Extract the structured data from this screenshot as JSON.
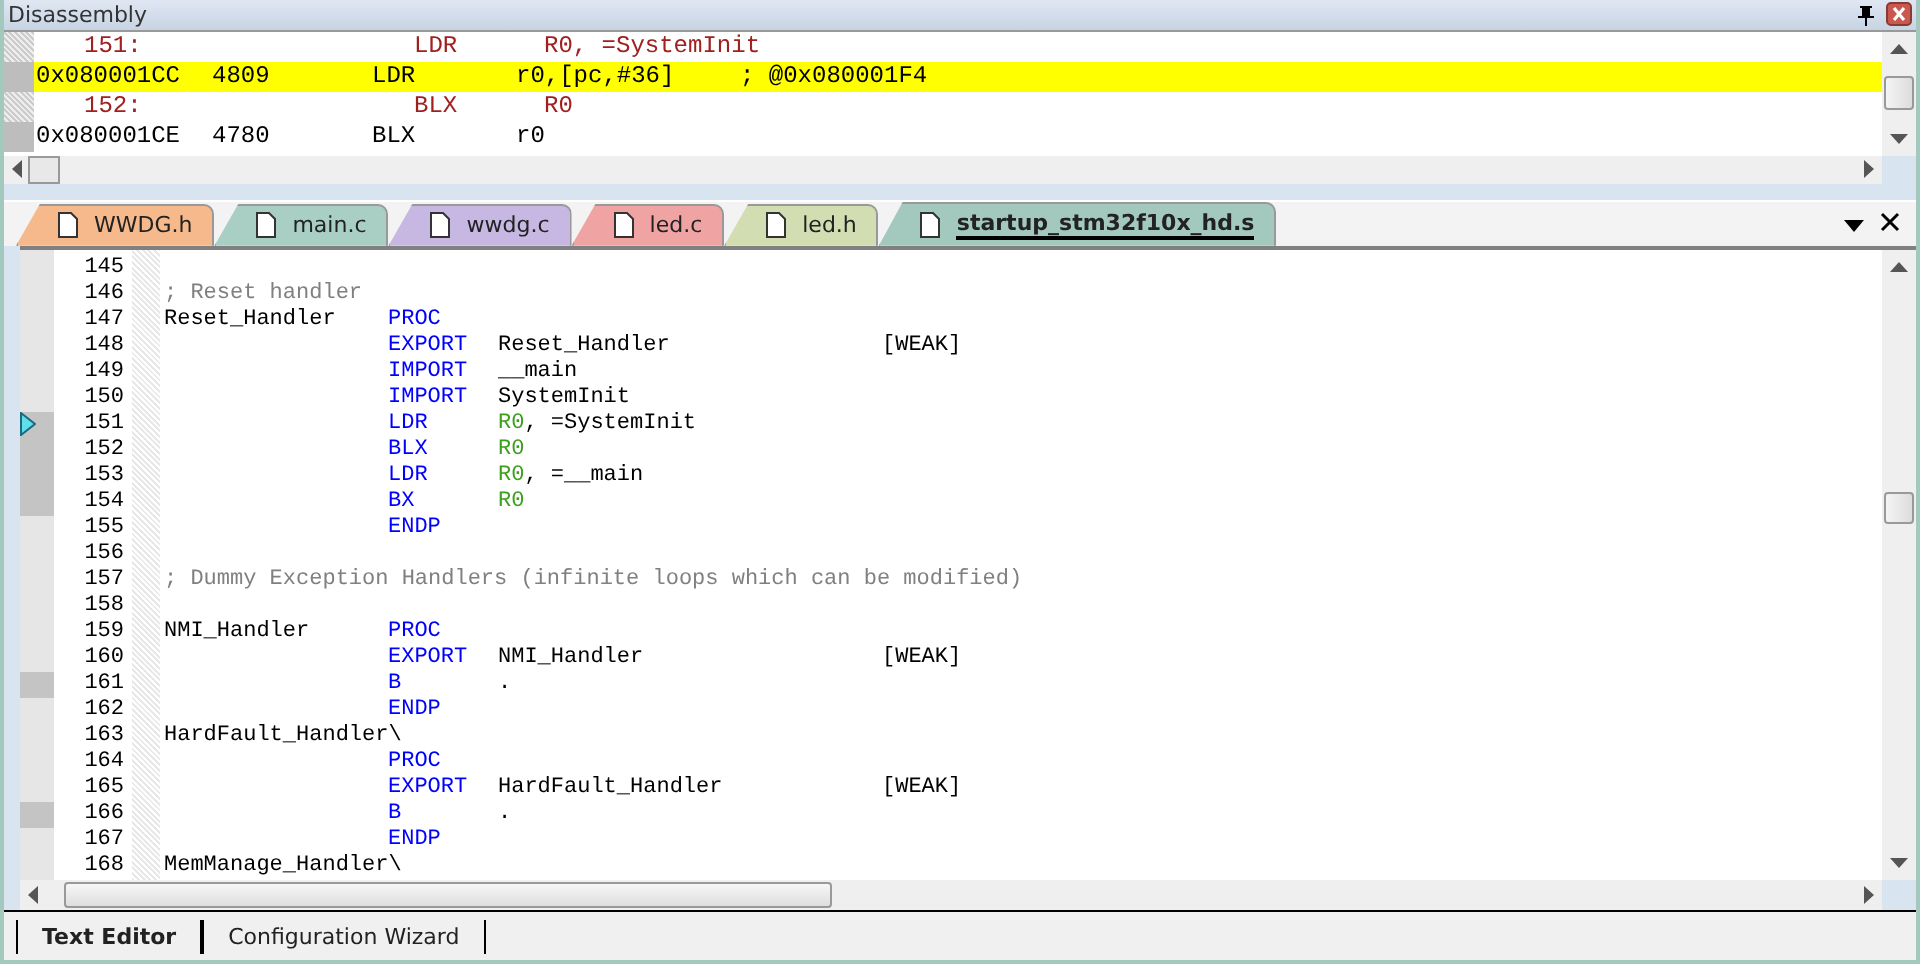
{
  "disassembly": {
    "title": "Disassembly",
    "lines": [
      {
        "kind": "source",
        "number": "151:",
        "op": "LDR",
        "args": "R0, =SystemInit",
        "selected": false
      },
      {
        "kind": "asm",
        "address": "0x080001CC",
        "hex": "4809",
        "op": "LDR",
        "args": "r0,[pc,#36]",
        "comment": "; @0x080001F4",
        "selected": true
      },
      {
        "kind": "source",
        "number": "152:",
        "op": "BLX",
        "args": "R0",
        "selected": false
      },
      {
        "kind": "asm",
        "address": "0x080001CE",
        "hex": "4780",
        "op": "BLX",
        "args": "r0",
        "selected": false
      }
    ]
  },
  "file_tabs": [
    {
      "label": "WWDG.h",
      "color": "#f5b98c",
      "selected": false
    },
    {
      "label": "main.c",
      "color": "#a9cfc4",
      "selected": false
    },
    {
      "label": "wwdg.c",
      "color": "#c7b7e3",
      "selected": false
    },
    {
      "label": "led.c",
      "color": "#f0a3a3",
      "selected": false
    },
    {
      "label": "led.h",
      "color": "#d3ddb2",
      "selected": false
    },
    {
      "label": "startup_stm32f10x_hd.s",
      "color": "#a3c9bf",
      "selected": true
    }
  ],
  "editor": {
    "lines": [
      {
        "number": "145",
        "executed": false,
        "current": false
      },
      {
        "number": "146",
        "comment": "; Reset handler",
        "executed": false,
        "current": false
      },
      {
        "number": "147",
        "label": "Reset_Handler",
        "op": "PROC",
        "executed": false,
        "current": false
      },
      {
        "number": "148",
        "op": "EXPORT",
        "args": "Reset_Handler",
        "attr": "[WEAK]",
        "executed": false,
        "current": false
      },
      {
        "number": "149",
        "op": "IMPORT",
        "args": "__main",
        "executed": false,
        "current": false
      },
      {
        "number": "150",
        "op": "IMPORT",
        "args": "SystemInit",
        "executed": false,
        "current": false
      },
      {
        "number": "151",
        "op": "LDR",
        "register": "R0",
        "args": ", =SystemInit",
        "executed": true,
        "current": true
      },
      {
        "number": "152",
        "op": "BLX",
        "register": "R0",
        "executed": true,
        "current": false
      },
      {
        "number": "153",
        "op": "LDR",
        "register": "R0",
        "args": ", =__main",
        "executed": true,
        "current": false
      },
      {
        "number": "154",
        "op": "BX",
        "register": "R0",
        "executed": true,
        "current": false
      },
      {
        "number": "155",
        "op": "ENDP",
        "executed": false,
        "current": false
      },
      {
        "number": "156",
        "executed": false,
        "current": false
      },
      {
        "number": "157",
        "comment": "; Dummy Exception Handlers (infinite loops which can be modified)",
        "executed": false,
        "current": false
      },
      {
        "number": "158",
        "executed": false,
        "current": false
      },
      {
        "number": "159",
        "label": "NMI_Handler",
        "op": "PROC",
        "executed": false,
        "current": false
      },
      {
        "number": "160",
        "op": "EXPORT",
        "args": "NMI_Handler",
        "attr": "[WEAK]",
        "executed": false,
        "current": false
      },
      {
        "number": "161",
        "op": "B",
        "args": ".",
        "executed": true,
        "current": false
      },
      {
        "number": "162",
        "op": "ENDP",
        "executed": false,
        "current": false
      },
      {
        "number": "163",
        "label": "HardFault_Handler\\",
        "executed": false,
        "current": false
      },
      {
        "number": "164",
        "op": "PROC",
        "executed": false,
        "current": false
      },
      {
        "number": "165",
        "op": "EXPORT",
        "args": "HardFault_Handler",
        "attr": "[WEAK]",
        "executed": false,
        "current": false
      },
      {
        "number": "166",
        "op": "B",
        "args": ".",
        "executed": true,
        "current": false
      },
      {
        "number": "167",
        "op": "ENDP",
        "executed": false,
        "current": false
      },
      {
        "number": "168",
        "label": "MemManage_Handler\\",
        "executed": false,
        "current": false
      }
    ]
  },
  "bottom_tabs": [
    {
      "label": "Text Editor",
      "selected": true
    },
    {
      "label": "Configuration Wizard",
      "selected": false
    }
  ]
}
